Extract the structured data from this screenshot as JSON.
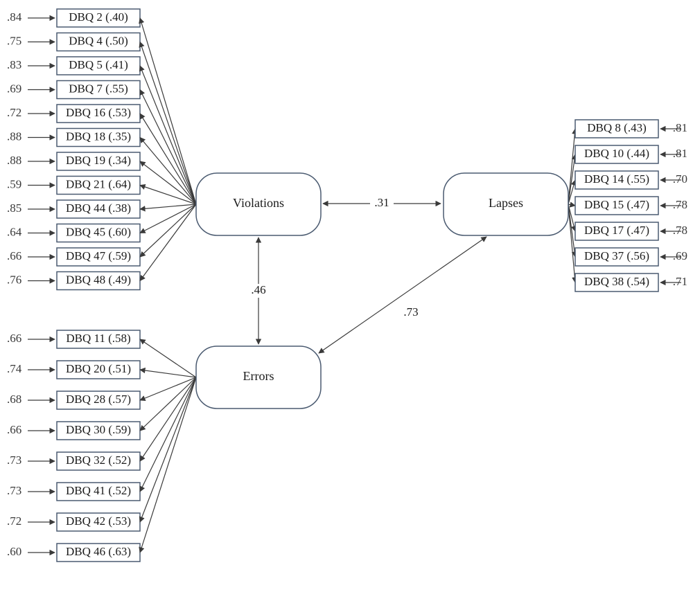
{
  "latents": {
    "violations": "Violations",
    "errors": "Errors",
    "lapses": "Lapses"
  },
  "correlations": {
    "viol_lapses": ".31",
    "viol_errors": ".46",
    "errors_lapses": ".73"
  },
  "violations_items": [
    {
      "err": ".84",
      "label": "DBQ 2 (.40)"
    },
    {
      "err": ".75",
      "label": "DBQ 4 (.50)"
    },
    {
      "err": ".83",
      "label": "DBQ 5 (.41)"
    },
    {
      "err": ".69",
      "label": "DBQ 7 (.55)"
    },
    {
      "err": ".72",
      "label": "DBQ 16 (.53)"
    },
    {
      "err": ".88",
      "label": "DBQ 18 (.35)"
    },
    {
      "err": ".88",
      "label": "DBQ 19 (.34)"
    },
    {
      "err": ".59",
      "label": "DBQ 21 (.64)"
    },
    {
      "err": ".85",
      "label": "DBQ 44 (.38)"
    },
    {
      "err": ".64",
      "label": "DBQ 45 (.60)"
    },
    {
      "err": ".66",
      "label": "DBQ 47 (.59)"
    },
    {
      "err": ".76",
      "label": "DBQ 48 (.49)"
    }
  ],
  "errors_items": [
    {
      "err": ".66",
      "label": "DBQ 11 (.58)"
    },
    {
      "err": ".74",
      "label": "DBQ 20 (.51)"
    },
    {
      "err": ".68",
      "label": "DBQ 28 (.57)"
    },
    {
      "err": ".66",
      "label": "DBQ 30 (.59)"
    },
    {
      "err": ".73",
      "label": "DBQ 32 (.52)"
    },
    {
      "err": ".73",
      "label": "DBQ 41 (.52)"
    },
    {
      "err": ".72",
      "label": "DBQ 42 (.53)"
    },
    {
      "err": ".60",
      "label": "DBQ 46 (.63)"
    }
  ],
  "lapses_items": [
    {
      "err": ".81",
      "label": "DBQ 8 (.43)"
    },
    {
      "err": ".81",
      "label": "DBQ 10 (.44)"
    },
    {
      "err": ".70",
      "label": "DBQ 14 (.55)"
    },
    {
      "err": ".78",
      "label": "DBQ 15 (.47)"
    },
    {
      "err": ".78",
      "label": "DBQ 17 (.47)"
    },
    {
      "err": ".69",
      "label": "DBQ 37 (.56)"
    },
    {
      "err": ".71",
      "label": "DBQ 38 (.54)"
    }
  ]
}
